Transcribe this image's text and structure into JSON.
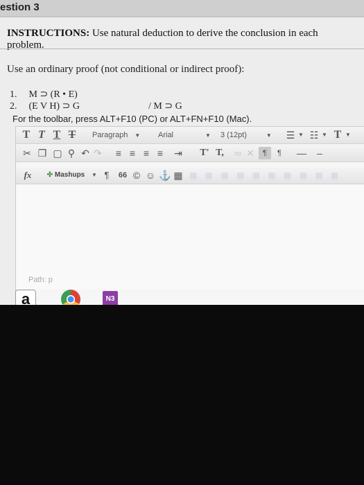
{
  "page": {
    "header_title": "estion 3",
    "instructions_label": "INSTRUCTIONS:",
    "instructions_text": "Use natural deduction to derive the conclusion in each problem.",
    "prompt": "Use an ordinary proof (not conditional or indirect proof):",
    "proof_lines": [
      {
        "num": "1.",
        "text": "M ⊃ (R • E)",
        "conclusion": ""
      },
      {
        "num": "2.",
        "text": "(E V H) ⊃ G",
        "conclusion": "/ M ⊃ G"
      }
    ],
    "toolbar_hint": "For the toolbar, press ALT+F10 (PC) or ALT+FN+F10 (Mac)."
  },
  "editor": {
    "row1": {
      "format_buttons": [
        "T",
        "T",
        "T",
        "T"
      ],
      "paragraph_select": "Paragraph",
      "font_select": "Arial",
      "size_select": "3 (12pt)"
    },
    "row2": {
      "superscript": "T'",
      "subscript": "T,"
    },
    "row3": {
      "function_label": "fx",
      "mashups_label": "Mashups",
      "pilcrow": "¶",
      "quote": "66"
    },
    "path_label": "Path:",
    "path_value": "p"
  },
  "taskbar": {
    "amazon_glyph": "a",
    "onenote_glyph": "N3"
  }
}
